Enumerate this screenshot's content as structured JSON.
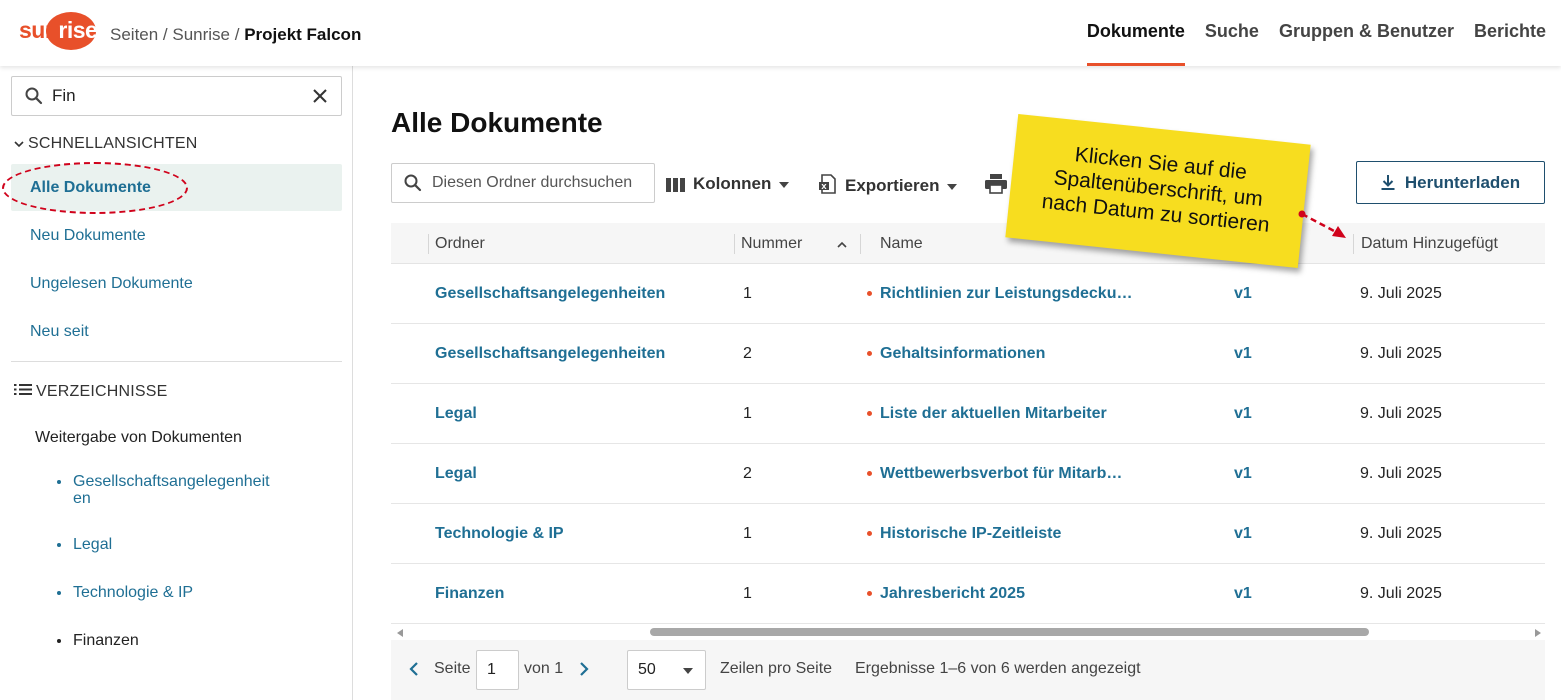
{
  "app": {
    "logo_text_1": "sun",
    "logo_text_2": "rise",
    "breadcrumb": {
      "parts": [
        "Seiten",
        "Sunrise"
      ],
      "separator": " / ",
      "current": "Projekt Falcon"
    },
    "nav": [
      {
        "label": "Dokumente",
        "active": true
      },
      {
        "label": "Suche",
        "active": false
      },
      {
        "label": "Gruppen & Benutzer",
        "active": false
      },
      {
        "label": "Berichte",
        "active": false
      }
    ],
    "accent_color": "#e8502a",
    "link_color": "#1f6f94"
  },
  "sidebar": {
    "search": {
      "value": "Fin",
      "icon": "search-icon",
      "clear_icon": "close-icon"
    },
    "quick_views": {
      "heading": "SCHNELLANSICHTEN",
      "items": [
        {
          "label": "Alle Dokumente",
          "active": true
        },
        {
          "label": "Neu Dokumente",
          "active": false
        },
        {
          "label": "Ungelesen Dokumente",
          "active": false
        },
        {
          "label": "Neu seit",
          "active": false
        }
      ]
    },
    "directories": {
      "heading": "VERZEICHNISSE",
      "root": "Weitergabe von Dokumenten",
      "items": [
        {
          "label_line1": "Gesellschaftsangelegenheit",
          "label_line2": "en",
          "link": true
        },
        {
          "label_line1": "Legal",
          "link": true
        },
        {
          "label_line1": "Technologie & IP",
          "link": true
        },
        {
          "label_line1": "Finanzen",
          "link": false
        }
      ]
    }
  },
  "main": {
    "title": "Alle Dokumente",
    "folder_search_placeholder": "Diesen Ordner durchsuchen",
    "toolbar": {
      "columns_label": "Kolonnen",
      "export_label": "Exportieren",
      "download_label": "Herunterladen"
    },
    "table": {
      "headers": {
        "folder": "Ordner",
        "number": "Nummer",
        "name": "Name",
        "date": "Datum Hinzugefügt"
      },
      "sort": {
        "column": "number",
        "direction": "ascending"
      },
      "rows": [
        {
          "folder": "Gesellschaftsangelegenheiten",
          "number": "1",
          "name": "Richtlinien zur Leistungsdecku…",
          "version": "v1",
          "date": "9. Juli 2025"
        },
        {
          "folder": "Gesellschaftsangelegenheiten",
          "number": "2",
          "name": "Gehaltsinformationen",
          "version": "v1",
          "date": "9. Juli 2025"
        },
        {
          "folder": "Legal",
          "number": "1",
          "name": "Liste der aktuellen Mitarbeiter",
          "version": "v1",
          "date": "9. Juli 2025"
        },
        {
          "folder": "Legal",
          "number": "2",
          "name": "Wettbewerbsverbot für Mitarb…",
          "version": "v1",
          "date": "9. Juli 2025"
        },
        {
          "folder": "Technologie & IP",
          "number": "1",
          "name": "Historische IP-Zeitleiste",
          "version": "v1",
          "date": "9. Juli 2025"
        },
        {
          "folder": "Finanzen",
          "number": "1",
          "name": "Jahresbericht 2025",
          "version": "v1",
          "date": "9. Juli 2025"
        }
      ]
    },
    "pagination": {
      "page_label": "Seite",
      "page_value": "1",
      "of_label": "von 1",
      "per_page_value": "50",
      "per_page_label": "Zeilen pro Seite",
      "results_text": "Ergebnisse 1–6 von 6 werden angezeigt"
    }
  },
  "annotation": {
    "note_lines": [
      "Klicken Sie auf die",
      "Spaltenüberschrift, um",
      "nach Datum zu sortieren"
    ],
    "note_color": "#f7dd1f",
    "highlight_color": "#d0021b"
  }
}
